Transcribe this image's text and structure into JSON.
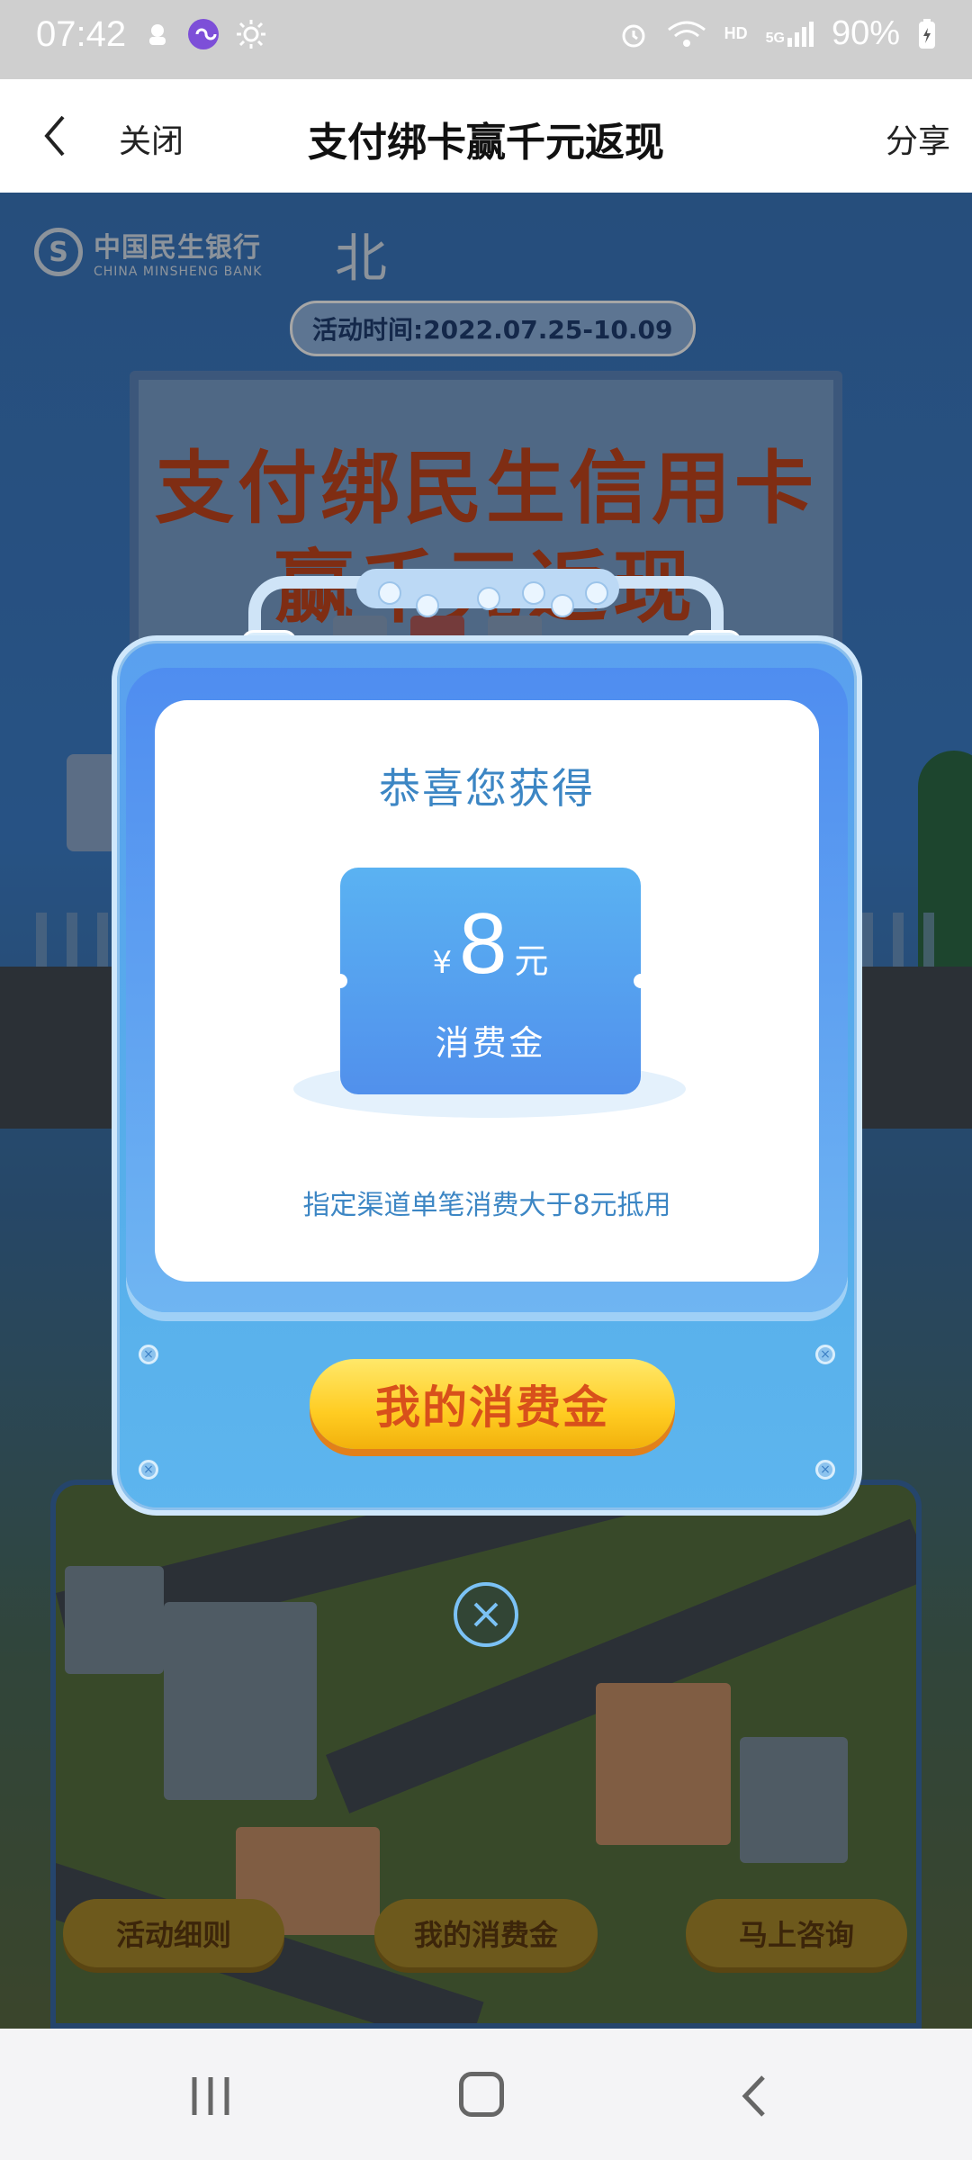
{
  "status_bar": {
    "time": "07:42",
    "battery": "90%",
    "left_icons": [
      "assistant-icon",
      "link-icon",
      "brightness-icon"
    ],
    "right_icons": [
      "alarm-icon",
      "wifi-icon",
      "hd-icon",
      "signal-5g-icon",
      "battery-icon"
    ],
    "hd_label": "HD",
    "network_label": "5G"
  },
  "header": {
    "close_label": "关闭",
    "title": "支付绑卡赢千元返现",
    "share_label": "分享"
  },
  "background": {
    "bank_name_cn": "中国民生银行",
    "bank_name_en": "CHINA MINSHENG BANK",
    "card_brand": "北",
    "activity_time": "活动时间:2022.07.25-10.09",
    "billboard_line1": "支付绑民生信用卡",
    "billboard_line2": "赢千元返现",
    "bottom_buttons": [
      "活动细则",
      "我的消费金",
      "马上咨询"
    ]
  },
  "modal": {
    "congrats": "恭喜您获得",
    "currency": "¥",
    "amount": "8",
    "unit": "元",
    "coupon_type": "消费金",
    "usage_note": "指定渠道单笔消费大于8元抵用",
    "action_button": "我的消费金"
  },
  "colors": {
    "accent_blue": "#3c86c4",
    "button_yellow": "#ffcc22",
    "button_text": "#d8501b"
  }
}
